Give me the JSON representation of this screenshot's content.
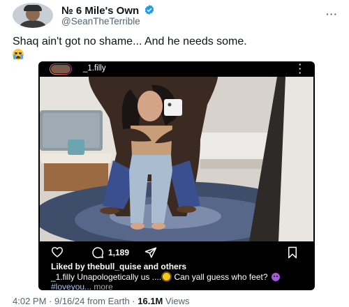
{
  "tweet": {
    "display_name": "№ 6 Mile's Own",
    "handle": "@SeanTheTerrible",
    "text": "Shaq ain't got no shame... And he needs some.",
    "time": "4:02 PM",
    "date": "9/16/24",
    "source_prefix": "from",
    "source": "Earth",
    "views_count": "16.1M",
    "views_label": "Views",
    "colors": {
      "verified": "#1d9bf0",
      "secondary_text": "#536471"
    }
  },
  "embed": {
    "username": "_1.filly",
    "comment_count": "1,189",
    "likes_prefix": "Liked by",
    "likes_user": "thebull_quise",
    "likes_suffix": "and others",
    "caption_user": "_1.filly",
    "caption_text_1": "Unapologetically us ....",
    "caption_text_2": "Can yall guess who feet?",
    "hashtag": "#loveyou...",
    "more_label": "more",
    "icons": [
      "heart-icon",
      "comment-icon",
      "share-icon",
      "bookmark-icon"
    ]
  }
}
